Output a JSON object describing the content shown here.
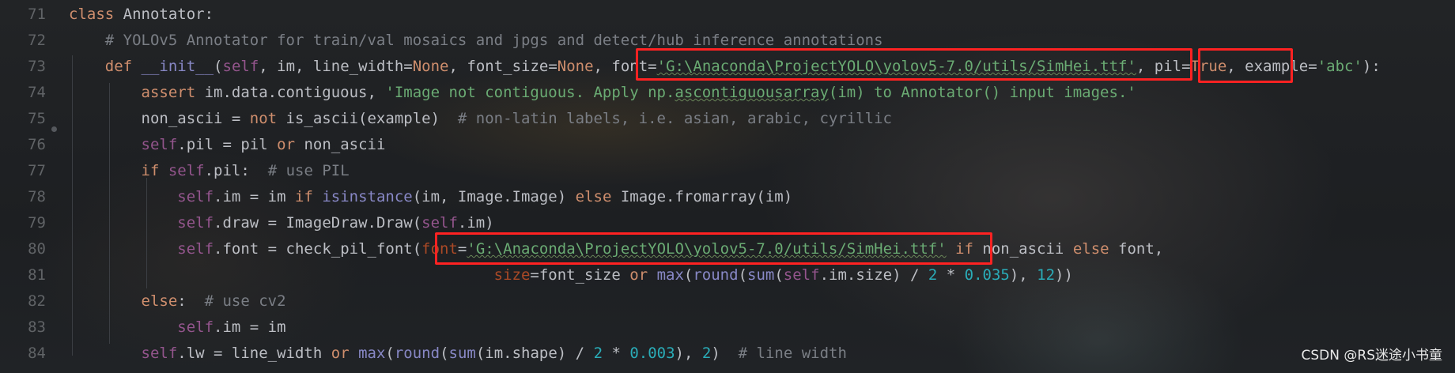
{
  "editor": {
    "lines": [
      {
        "n": "71",
        "tokens": [
          {
            "t": "class ",
            "c": "kw"
          },
          {
            "t": "Annotator:",
            "c": ""
          }
        ]
      },
      {
        "n": "72",
        "tokens": [
          {
            "t": "    ",
            "c": ""
          },
          {
            "t": "# YOLOv5 Annotator for train/val mosaics and jpgs and detect/hub inference annotations",
            "c": "cm"
          }
        ]
      },
      {
        "n": "73",
        "tokens": [
          {
            "t": "    ",
            "c": ""
          },
          {
            "t": "def ",
            "c": "kw"
          },
          {
            "t": "__init__",
            "c": "bi"
          },
          {
            "t": "(",
            "c": ""
          },
          {
            "t": "self",
            "c": "sl"
          },
          {
            "t": ", im, line_width=",
            "c": ""
          },
          {
            "t": "None",
            "c": "kw"
          },
          {
            "t": ", font_size=",
            "c": ""
          },
          {
            "t": "None",
            "c": "kw"
          },
          {
            "t": ", font=",
            "c": ""
          },
          {
            "t": "'G:\\Anaconda\\ProjectYOLO\\yolov5-7.0/utils/SimHei.ttf'",
            "c": "st und"
          },
          {
            "t": ", pil=",
            "c": ""
          },
          {
            "t": "True",
            "c": "kw"
          },
          {
            "t": ", example=",
            "c": ""
          },
          {
            "t": "'abc'",
            "c": "st"
          },
          {
            "t": "):",
            "c": ""
          }
        ]
      },
      {
        "n": "74",
        "tokens": [
          {
            "t": "        ",
            "c": ""
          },
          {
            "t": "assert ",
            "c": "kw"
          },
          {
            "t": "im.data.contiguous, ",
            "c": ""
          },
          {
            "t": "'Image not contiguous. Apply np.",
            "c": "st"
          },
          {
            "t": "ascontiguousarray",
            "c": "st und"
          },
          {
            "t": "(im) to Annotator() input images.'",
            "c": "st"
          }
        ]
      },
      {
        "n": "75",
        "tokens": [
          {
            "t": "        non_ascii = ",
            "c": ""
          },
          {
            "t": "not ",
            "c": "kw"
          },
          {
            "t": "is_ascii(example)  ",
            "c": ""
          },
          {
            "t": "# non-latin labels, i.e. asian, arabic, cyrillic",
            "c": "cm"
          }
        ]
      },
      {
        "n": "76",
        "tokens": [
          {
            "t": "        ",
            "c": ""
          },
          {
            "t": "self",
            "c": "sl"
          },
          {
            "t": ".pil = pil ",
            "c": ""
          },
          {
            "t": "or ",
            "c": "kw"
          },
          {
            "t": "non_ascii",
            "c": ""
          }
        ]
      },
      {
        "n": "77",
        "tokens": [
          {
            "t": "        ",
            "c": ""
          },
          {
            "t": "if ",
            "c": "kw"
          },
          {
            "t": "self",
            "c": "sl"
          },
          {
            "t": ".pil:  ",
            "c": ""
          },
          {
            "t": "# use PIL",
            "c": "cm"
          }
        ]
      },
      {
        "n": "78",
        "tokens": [
          {
            "t": "            ",
            "c": ""
          },
          {
            "t": "self",
            "c": "sl"
          },
          {
            "t": ".im = im ",
            "c": ""
          },
          {
            "t": "if ",
            "c": "kw"
          },
          {
            "t": "isinstance",
            "c": "bi"
          },
          {
            "t": "(im, Image.Image) ",
            "c": ""
          },
          {
            "t": "else ",
            "c": "kw"
          },
          {
            "t": "Image.fromarray(im)",
            "c": ""
          }
        ]
      },
      {
        "n": "79",
        "tokens": [
          {
            "t": "            ",
            "c": ""
          },
          {
            "t": "self",
            "c": "sl"
          },
          {
            "t": ".draw = ImageDraw.Draw(",
            "c": ""
          },
          {
            "t": "self",
            "c": "sl"
          },
          {
            "t": ".im)",
            "c": ""
          }
        ]
      },
      {
        "n": "80",
        "tokens": [
          {
            "t": "            ",
            "c": ""
          },
          {
            "t": "self",
            "c": "sl"
          },
          {
            "t": ".font = check_pil_font(",
            "c": ""
          },
          {
            "t": "font",
            "c": "pm"
          },
          {
            "t": "=",
            "c": ""
          },
          {
            "t": "'G:\\Anaconda\\ProjectYOLO\\yolov5-7.0/utils/SimHei.ttf'",
            "c": "st und"
          },
          {
            "t": " ",
            "c": ""
          },
          {
            "t": "if ",
            "c": "kw"
          },
          {
            "t": "non_ascii ",
            "c": ""
          },
          {
            "t": "else ",
            "c": "kw"
          },
          {
            "t": "font,",
            "c": ""
          }
        ]
      },
      {
        "n": "81",
        "tokens": [
          {
            "t": "                                               ",
            "c": ""
          },
          {
            "t": "size",
            "c": "pm"
          },
          {
            "t": "=font_size ",
            "c": ""
          },
          {
            "t": "or ",
            "c": "kw"
          },
          {
            "t": "max",
            "c": "bi"
          },
          {
            "t": "(",
            "c": ""
          },
          {
            "t": "round",
            "c": "bi"
          },
          {
            "t": "(",
            "c": ""
          },
          {
            "t": "sum",
            "c": "bi"
          },
          {
            "t": "(",
            "c": ""
          },
          {
            "t": "self",
            "c": "sl"
          },
          {
            "t": ".im.size) / ",
            "c": ""
          },
          {
            "t": "2",
            "c": "nm"
          },
          {
            "t": " * ",
            "c": ""
          },
          {
            "t": "0.035",
            "c": "nm"
          },
          {
            "t": "), ",
            "c": ""
          },
          {
            "t": "12",
            "c": "nm"
          },
          {
            "t": "))",
            "c": ""
          }
        ]
      },
      {
        "n": "82",
        "tokens": [
          {
            "t": "        ",
            "c": ""
          },
          {
            "t": "else",
            "c": "kw"
          },
          {
            "t": ":  ",
            "c": ""
          },
          {
            "t": "# use cv2",
            "c": "cm"
          }
        ]
      },
      {
        "n": "83",
        "tokens": [
          {
            "t": "            ",
            "c": ""
          },
          {
            "t": "self",
            "c": "sl"
          },
          {
            "t": ".im = im",
            "c": ""
          }
        ]
      },
      {
        "n": "84",
        "tokens": [
          {
            "t": "        ",
            "c": ""
          },
          {
            "t": "self",
            "c": "sl"
          },
          {
            "t": ".lw = line_width ",
            "c": ""
          },
          {
            "t": "or ",
            "c": "kw"
          },
          {
            "t": "max",
            "c": "bi"
          },
          {
            "t": "(",
            "c": ""
          },
          {
            "t": "round",
            "c": "bi"
          },
          {
            "t": "(",
            "c": ""
          },
          {
            "t": "sum",
            "c": "bi"
          },
          {
            "t": "(im.shape) / ",
            "c": ""
          },
          {
            "t": "2",
            "c": "nm"
          },
          {
            "t": " * ",
            "c": ""
          },
          {
            "t": "0.003",
            "c": "nm"
          },
          {
            "t": "), ",
            "c": ""
          },
          {
            "t": "2",
            "c": "nm"
          },
          {
            "t": ")  ",
            "c": ""
          },
          {
            "t": "# line width",
            "c": "cm"
          }
        ]
      }
    ]
  },
  "watermark": "CSDN @RS迷途小书童",
  "colors": {
    "highlight_box": "#ff2222",
    "keyword": "#cf8e6d",
    "string": "#6aab73",
    "comment": "#7a7e85",
    "self": "#94558d",
    "number": "#2aacb8",
    "builtin": "#8888c6",
    "param": "#aa4926"
  }
}
